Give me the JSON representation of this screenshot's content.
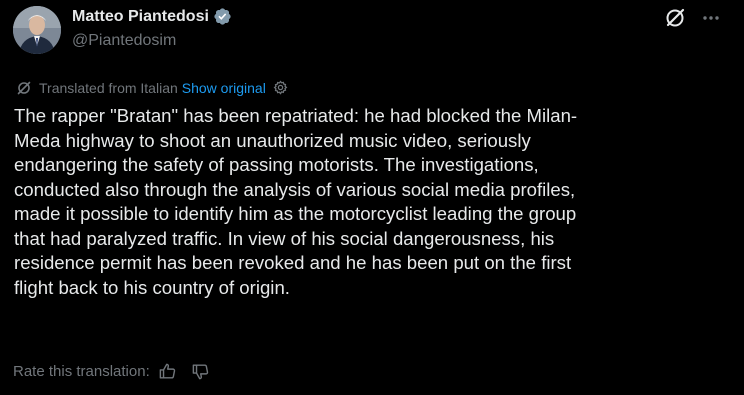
{
  "author": {
    "name": "Matteo Piantedosi",
    "handle": "@Piantedosim",
    "verified_icon": "verified-badge-icon"
  },
  "header_actions": {
    "grok_icon": "grok-icon",
    "more_icon": "more-dots-icon"
  },
  "translation": {
    "label": "Translated from Italian",
    "show_original": "Show original",
    "settings_icon": "gear-icon"
  },
  "post": {
    "text": "The rapper \"Bratan\" has been repatriated: he had blocked the Milan-\nMeda highway to shoot an unauthorized music video, seriously\nendangering the safety of passing motorists. The investigations,\nconducted also through the analysis of various social media profiles,\nmade it possible to identify him as the motorcyclist leading the group\nthat had paralyzed traffic. In view of his social dangerousness, his\nresidence permit has been revoked and he has been put on the first\nflight back to his country of origin."
  },
  "rating": {
    "label": "Rate this translation:",
    "thumbs_up_icon": "thumbs-up-icon",
    "thumbs_down_icon": "thumbs-down-icon"
  },
  "colors": {
    "background": "#000000",
    "text": "#e7e9ea",
    "muted": "#71767b",
    "link": "#1d9bf0",
    "verified": "#829aab"
  }
}
